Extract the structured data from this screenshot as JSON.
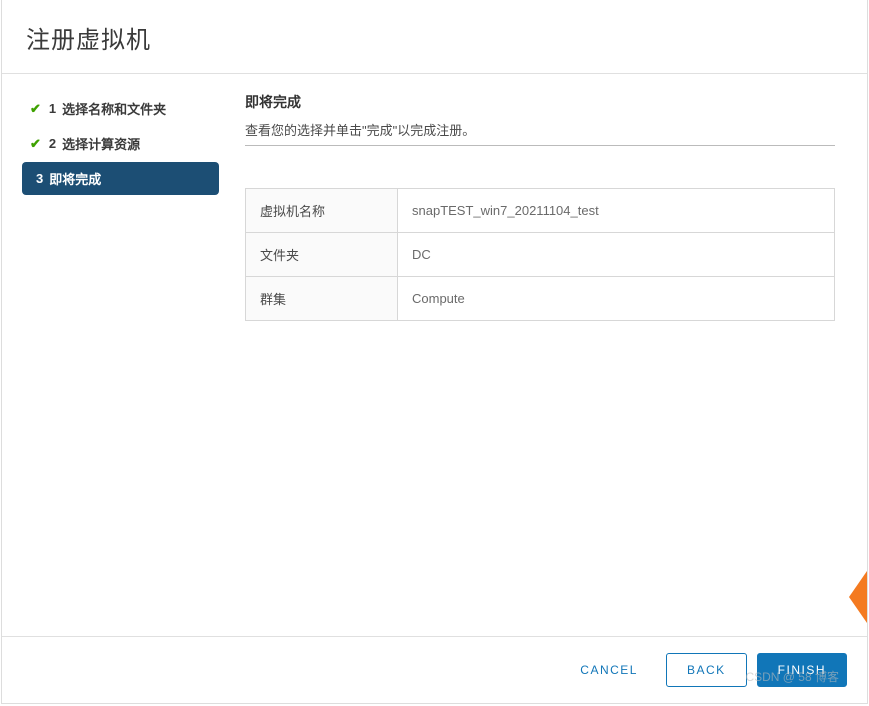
{
  "dialog": {
    "title": "注册虚拟机"
  },
  "steps": {
    "items": [
      {
        "num": "1",
        "label": "选择名称和文件夹"
      },
      {
        "num": "2",
        "label": "选择计算资源"
      },
      {
        "num": "3",
        "label": "即将完成"
      }
    ]
  },
  "content": {
    "heading": "即将完成",
    "description": "查看您的选择并单击\"完成\"以完成注册。"
  },
  "summary": {
    "rows": [
      {
        "key": "虚拟机名称",
        "value": "snapTEST_win7_20211104_test"
      },
      {
        "key": "文件夹",
        "value": "DC"
      },
      {
        "key": "群集",
        "value": "Compute"
      }
    ]
  },
  "footer": {
    "cancel": "CANCEL",
    "back": "BACK",
    "finish": "FINISH"
  },
  "watermark": "CSDN @ 58 博客"
}
